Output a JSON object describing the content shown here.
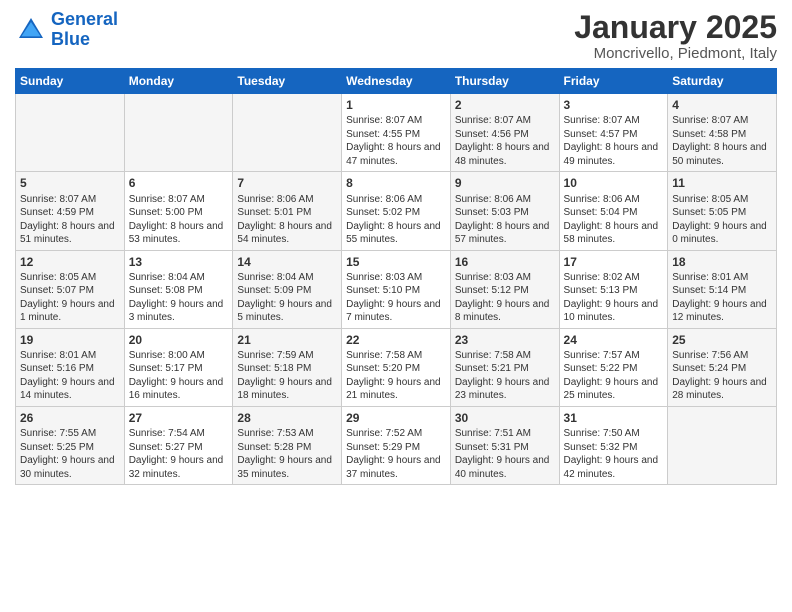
{
  "logo": {
    "line1": "General",
    "line2": "Blue"
  },
  "title": "January 2025",
  "subtitle": "Moncrivello, Piedmont, Italy",
  "weekdays": [
    "Sunday",
    "Monday",
    "Tuesday",
    "Wednesday",
    "Thursday",
    "Friday",
    "Saturday"
  ],
  "weeks": [
    [
      {
        "day": "",
        "info": ""
      },
      {
        "day": "",
        "info": ""
      },
      {
        "day": "",
        "info": ""
      },
      {
        "day": "1",
        "info": "Sunrise: 8:07 AM\nSunset: 4:55 PM\nDaylight: 8 hours and 47 minutes."
      },
      {
        "day": "2",
        "info": "Sunrise: 8:07 AM\nSunset: 4:56 PM\nDaylight: 8 hours and 48 minutes."
      },
      {
        "day": "3",
        "info": "Sunrise: 8:07 AM\nSunset: 4:57 PM\nDaylight: 8 hours and 49 minutes."
      },
      {
        "day": "4",
        "info": "Sunrise: 8:07 AM\nSunset: 4:58 PM\nDaylight: 8 hours and 50 minutes."
      }
    ],
    [
      {
        "day": "5",
        "info": "Sunrise: 8:07 AM\nSunset: 4:59 PM\nDaylight: 8 hours and 51 minutes."
      },
      {
        "day": "6",
        "info": "Sunrise: 8:07 AM\nSunset: 5:00 PM\nDaylight: 8 hours and 53 minutes."
      },
      {
        "day": "7",
        "info": "Sunrise: 8:06 AM\nSunset: 5:01 PM\nDaylight: 8 hours and 54 minutes."
      },
      {
        "day": "8",
        "info": "Sunrise: 8:06 AM\nSunset: 5:02 PM\nDaylight: 8 hours and 55 minutes."
      },
      {
        "day": "9",
        "info": "Sunrise: 8:06 AM\nSunset: 5:03 PM\nDaylight: 8 hours and 57 minutes."
      },
      {
        "day": "10",
        "info": "Sunrise: 8:06 AM\nSunset: 5:04 PM\nDaylight: 8 hours and 58 minutes."
      },
      {
        "day": "11",
        "info": "Sunrise: 8:05 AM\nSunset: 5:05 PM\nDaylight: 9 hours and 0 minutes."
      }
    ],
    [
      {
        "day": "12",
        "info": "Sunrise: 8:05 AM\nSunset: 5:07 PM\nDaylight: 9 hours and 1 minute."
      },
      {
        "day": "13",
        "info": "Sunrise: 8:04 AM\nSunset: 5:08 PM\nDaylight: 9 hours and 3 minutes."
      },
      {
        "day": "14",
        "info": "Sunrise: 8:04 AM\nSunset: 5:09 PM\nDaylight: 9 hours and 5 minutes."
      },
      {
        "day": "15",
        "info": "Sunrise: 8:03 AM\nSunset: 5:10 PM\nDaylight: 9 hours and 7 minutes."
      },
      {
        "day": "16",
        "info": "Sunrise: 8:03 AM\nSunset: 5:12 PM\nDaylight: 9 hours and 8 minutes."
      },
      {
        "day": "17",
        "info": "Sunrise: 8:02 AM\nSunset: 5:13 PM\nDaylight: 9 hours and 10 minutes."
      },
      {
        "day": "18",
        "info": "Sunrise: 8:01 AM\nSunset: 5:14 PM\nDaylight: 9 hours and 12 minutes."
      }
    ],
    [
      {
        "day": "19",
        "info": "Sunrise: 8:01 AM\nSunset: 5:16 PM\nDaylight: 9 hours and 14 minutes."
      },
      {
        "day": "20",
        "info": "Sunrise: 8:00 AM\nSunset: 5:17 PM\nDaylight: 9 hours and 16 minutes."
      },
      {
        "day": "21",
        "info": "Sunrise: 7:59 AM\nSunset: 5:18 PM\nDaylight: 9 hours and 18 minutes."
      },
      {
        "day": "22",
        "info": "Sunrise: 7:58 AM\nSunset: 5:20 PM\nDaylight: 9 hours and 21 minutes."
      },
      {
        "day": "23",
        "info": "Sunrise: 7:58 AM\nSunset: 5:21 PM\nDaylight: 9 hours and 23 minutes."
      },
      {
        "day": "24",
        "info": "Sunrise: 7:57 AM\nSunset: 5:22 PM\nDaylight: 9 hours and 25 minutes."
      },
      {
        "day": "25",
        "info": "Sunrise: 7:56 AM\nSunset: 5:24 PM\nDaylight: 9 hours and 28 minutes."
      }
    ],
    [
      {
        "day": "26",
        "info": "Sunrise: 7:55 AM\nSunset: 5:25 PM\nDaylight: 9 hours and 30 minutes."
      },
      {
        "day": "27",
        "info": "Sunrise: 7:54 AM\nSunset: 5:27 PM\nDaylight: 9 hours and 32 minutes."
      },
      {
        "day": "28",
        "info": "Sunrise: 7:53 AM\nSunset: 5:28 PM\nDaylight: 9 hours and 35 minutes."
      },
      {
        "day": "29",
        "info": "Sunrise: 7:52 AM\nSunset: 5:29 PM\nDaylight: 9 hours and 37 minutes."
      },
      {
        "day": "30",
        "info": "Sunrise: 7:51 AM\nSunset: 5:31 PM\nDaylight: 9 hours and 40 minutes."
      },
      {
        "day": "31",
        "info": "Sunrise: 7:50 AM\nSunset: 5:32 PM\nDaylight: 9 hours and 42 minutes."
      },
      {
        "day": "",
        "info": ""
      }
    ]
  ]
}
